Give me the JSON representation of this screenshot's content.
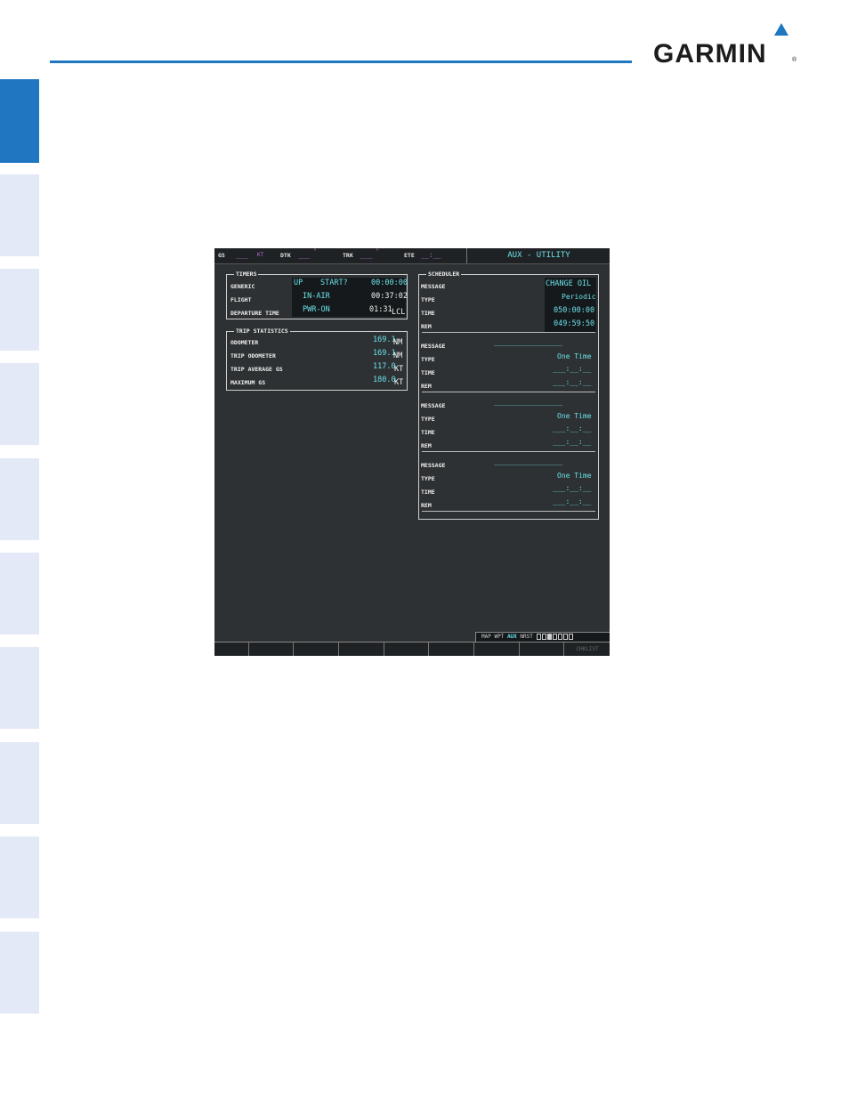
{
  "brand": {
    "name": "GARMIN",
    "reg": "®"
  },
  "top_bar": {
    "gs": {
      "label": "GS",
      "value": "___",
      "unit": "KT"
    },
    "dtk": {
      "label": "DTK",
      "value": "___",
      "deg": "°"
    },
    "trk": {
      "label": "TRK",
      "value": "___",
      "deg": "°"
    },
    "ete": {
      "label": "ETE",
      "value": "__:__"
    },
    "page_title": "AUX - UTILITY"
  },
  "timers": {
    "title": "TIMERS",
    "rows": [
      {
        "label": "GENERIC",
        "mode": "UP",
        "action": "START?",
        "value": "00:00:00"
      },
      {
        "label": "FLIGHT",
        "mode": "IN-AIR",
        "value": "00:37:02"
      },
      {
        "label": "DEPARTURE TIME",
        "mode": "PWR-ON",
        "value": "01:31",
        "unit": "LCL"
      }
    ]
  },
  "trip_statistics": {
    "title": "TRIP STATISTICS",
    "rows": [
      {
        "label": "ODOMETER",
        "value": "169.1",
        "unit": "NM"
      },
      {
        "label": "TRIP ODOMETER",
        "value": "169.1",
        "unit": "NM"
      },
      {
        "label": "TRIP AVERAGE GS",
        "value": "117.0",
        "unit": "KT"
      },
      {
        "label": "MAXIMUM GS",
        "value": "180.0",
        "unit": "KT"
      }
    ]
  },
  "scheduler": {
    "title": "SCHEDULER",
    "labels": {
      "message": "MESSAGE",
      "type": "TYPE",
      "time": "TIME",
      "rem": "REM"
    },
    "entries": [
      {
        "message": "CHANGE OIL",
        "type": "Periodic",
        "time": "050:00:00",
        "rem": "049:59:50"
      },
      {
        "message": "________________",
        "type": "One Time",
        "time": "___:__:__",
        "rem": "___:__:__"
      },
      {
        "message": "________________",
        "type": "One Time",
        "time": "___:__:__",
        "rem": "___:__:__"
      },
      {
        "message": "________________",
        "type": "One Time",
        "time": "___:__:__",
        "rem": "___:__:__"
      }
    ]
  },
  "nav_strip": {
    "groups": [
      "MAP",
      "WPT",
      "AUX",
      "NRST"
    ],
    "active": "AUX",
    "pages_total": 7,
    "page_current": 3
  },
  "softkeys": {
    "last_label": "CHKLIST"
  },
  "colors": {
    "accent": "#1f77c1",
    "cyan": "#6be0e8",
    "magenta": "#c16adf",
    "screen_bg": "#2d3133",
    "side_tab": "#e3e9f7"
  }
}
